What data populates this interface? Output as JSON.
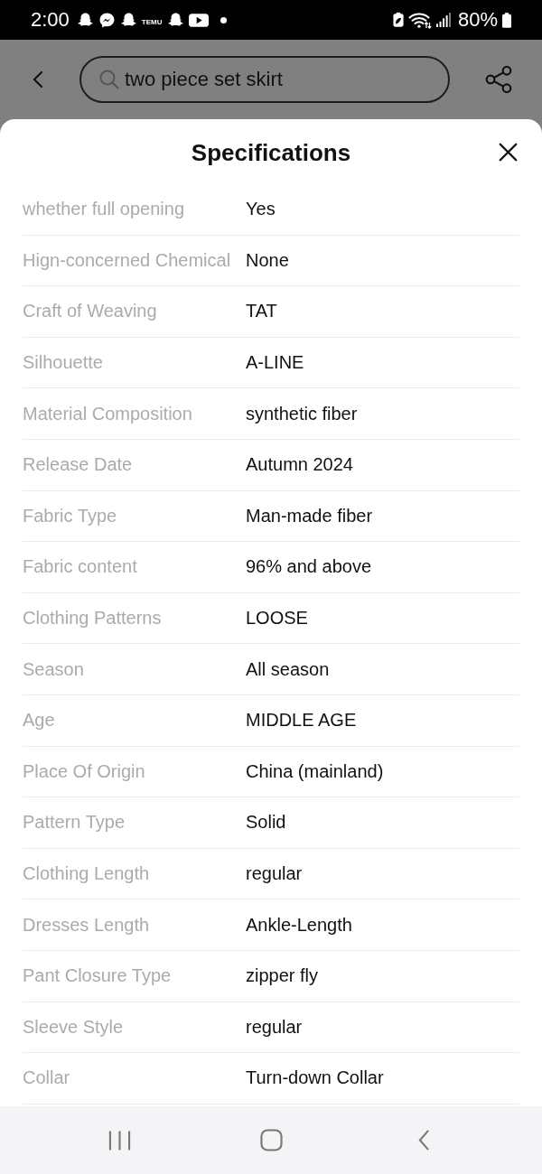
{
  "status_bar": {
    "time": "2:00",
    "notifications": [
      {
        "kind": "ghost"
      },
      {
        "kind": "messenger"
      },
      {
        "kind": "ghost"
      },
      {
        "kind": "badge",
        "label": "TEMU"
      },
      {
        "kind": "ghost"
      },
      {
        "kind": "video"
      },
      {
        "kind": "dot"
      }
    ],
    "battery_text": "80%"
  },
  "header": {
    "search": {
      "value": "two piece set skirt"
    }
  },
  "sheet": {
    "title": "Specifications",
    "specs": [
      {
        "label": "whether full opening",
        "value": "Yes"
      },
      {
        "label": "Hign-concerned Chemical",
        "value": "None"
      },
      {
        "label": "Craft of Weaving",
        "value": "TAT"
      },
      {
        "label": "Silhouette",
        "value": "A-LINE"
      },
      {
        "label": "Material Composition",
        "value": "synthetic fiber"
      },
      {
        "label": "Release Date",
        "value": "Autumn 2024"
      },
      {
        "label": "Fabric Type",
        "value": "Man-made fiber"
      },
      {
        "label": "Fabric content",
        "value": "96% and above"
      },
      {
        "label": "Clothing Patterns",
        "value": "LOOSE"
      },
      {
        "label": "Season",
        "value": "All season"
      },
      {
        "label": "Age",
        "value": "MIDDLE AGE"
      },
      {
        "label": "Place Of Origin",
        "value": "China (mainland)"
      },
      {
        "label": "Pattern Type",
        "value": "Solid"
      },
      {
        "label": "Clothing Length",
        "value": "regular"
      },
      {
        "label": "Dresses Length",
        "value": "Ankle-Length"
      },
      {
        "label": "Pant Closure Type",
        "value": "zipper fly"
      },
      {
        "label": "Sleeve Style",
        "value": "regular"
      },
      {
        "label": "Collar",
        "value": "Turn-down Collar"
      }
    ]
  }
}
